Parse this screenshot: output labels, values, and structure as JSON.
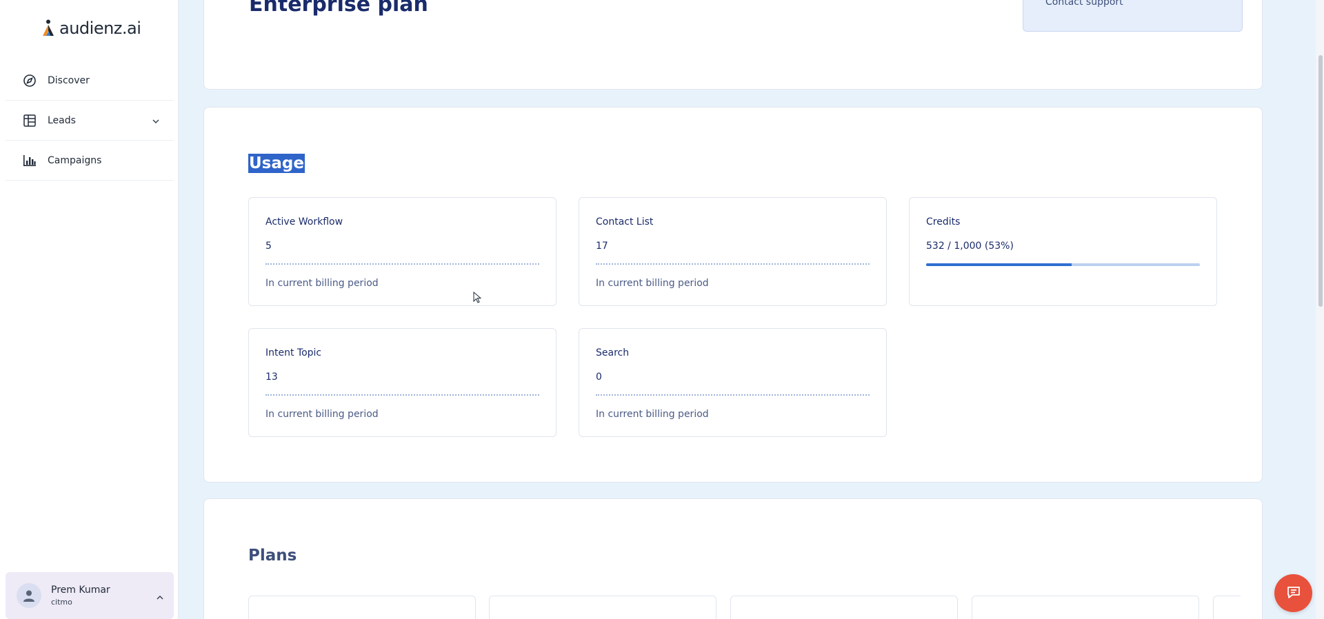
{
  "brand": {
    "name": "audienz.ai"
  },
  "sidebar": {
    "items": [
      {
        "label": "Discover",
        "icon": "compass-icon"
      },
      {
        "label": "Leads",
        "icon": "table-icon",
        "has_submenu": true
      },
      {
        "label": "Campaigns",
        "icon": "bar-chart-icon"
      }
    ],
    "user": {
      "name": "Prem Kumar",
      "org": "citmo"
    }
  },
  "plan": {
    "title": "Enterprise plan",
    "support_link": "Contact support"
  },
  "usage": {
    "title": "Usage",
    "stats": [
      {
        "label": "Active Workflow",
        "value": "5",
        "sub": "In current billing period"
      },
      {
        "label": "Contact List",
        "value": "17",
        "sub": "In current billing period"
      },
      {
        "label": "Credits",
        "value": "532 / 1,000 (53%)",
        "progress": 0.532
      },
      {
        "label": "Intent Topic",
        "value": "13",
        "sub": "In current billing period"
      },
      {
        "label": "Search",
        "value": "0",
        "sub": "In current billing period"
      }
    ]
  },
  "plans": {
    "title": "Plans"
  },
  "colors": {
    "accent": "#2f64c9",
    "chat": "#e8513c",
    "support_bg": "#e6eefc"
  }
}
